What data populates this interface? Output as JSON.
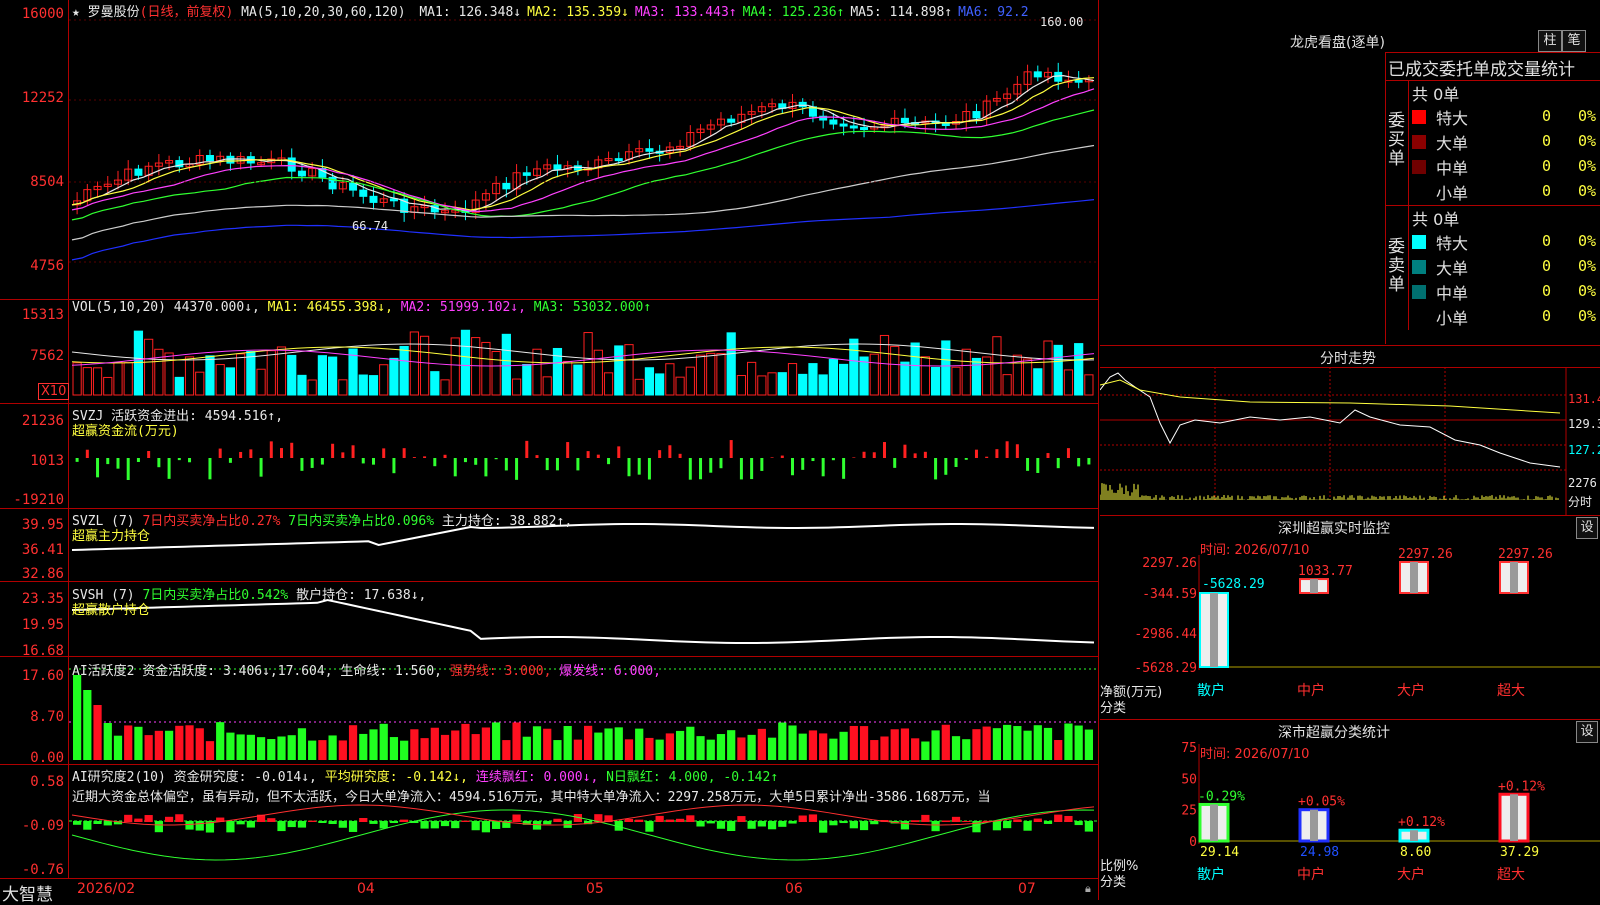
{
  "stock": {
    "name": "罗曼股份",
    "period": "(日线，前复权)",
    "ma_header": "MA(5,10,20,30,60,120)",
    "ma_values": [
      {
        "label": "MA1:",
        "value": "126.348",
        "arrow": "↓",
        "color": "#e8e8e8"
      },
      {
        "label": "MA2:",
        "value": "135.359",
        "arrow": "↓",
        "color": "#ffff40"
      },
      {
        "label": "MA3:",
        "value": "133.443",
        "arrow": "↑",
        "color": "#ff40ff"
      },
      {
        "label": "MA4:",
        "value": "125.236",
        "arrow": "↑",
        "color": "#30ff30"
      },
      {
        "label": "MA5:",
        "value": "114.898",
        "arrow": "↑",
        "color": "#e8e8e8"
      },
      {
        "label": "MA6:",
        "value": "92.2",
        "arrow": "",
        "color": "#4060ff"
      }
    ],
    "high_label": "160.00",
    "low_label": "66.74",
    "price_axis": [
      "16000",
      "12252",
      "8504",
      "4756"
    ]
  },
  "volume": {
    "header": "VOL(5,10,20)",
    "value": "44370.000↓,",
    "ma1": "MA1: 46455.398↓,",
    "ma2": "MA2: 51999.102↓,",
    "ma3": "MA3: 53032.000↑",
    "axis": [
      "15313",
      "7562"
    ],
    "unit": "X10"
  },
  "svzj": {
    "header": "SVZJ  活跃资金进出: 4594.516↑,",
    "sub": "超赢资金流(万元)",
    "axis": [
      "21236",
      "1013",
      "-19210"
    ]
  },
  "svzl": {
    "header_prefix": "SVZL (7)",
    "buy_ratio": "7日内买卖净占比0.27%",
    "net_ratio": "7日内买卖净占比0.096%",
    "main": "主力持仓: 38.882↑,",
    "sub": "超赢主力持仓",
    "axis": [
      "39.95",
      "36.41",
      "32.86"
    ]
  },
  "svsh": {
    "header_prefix": "SVSH (7)",
    "net_ratio": "7日内买卖净占比0.542%",
    "retail": "散户持仓: 17.638↓,",
    "sub": "超赢散户持仓",
    "axis": [
      "23.35",
      "19.95",
      "16.68"
    ]
  },
  "ai_active": {
    "header": "AI活跃度2 资金活跃度: 3.406↓,17.604,",
    "life": "生命线: 1.560,",
    "strong": "强势线: 3.000,",
    "burst": "爆发线: 6.000,",
    "axis": [
      "17.60",
      "8.70",
      "0.00"
    ]
  },
  "ai_research": {
    "header": "AI研究度2(10) 资金研究度: -0.014↓,",
    "avg": "平均研究度: -0.142↓,",
    "cont": "连续飘红: 0.000↓,",
    "nday": "N日飘红: 4.000, -0.142↑",
    "comment": "近期大资金总体偏空，虽有异动，但不太活跃，今日大单净流入：4594.516万元，其中特大单净流入：2297.258万元，大单5日累计净出-3586.168万元，当",
    "axis": [
      "0.58",
      "-0.09",
      "-0.76"
    ]
  },
  "date_axis": {
    "brand": "大智慧",
    "labels": [
      "2026/02",
      "04",
      "05",
      "06",
      "07"
    ]
  },
  "dragon": {
    "title": "龙虎看盘(逐单)",
    "btn1": "柱",
    "btn2": "笔",
    "subtitle": "已成交委托单成交量统计",
    "buy_side": "委买单",
    "sell_side": "委卖单",
    "buy_total": "共 0单",
    "sell_total": "共 0单",
    "buy_rows": [
      {
        "label": "特大",
        "count": "0",
        "pct": "0%",
        "color": "#ff0000"
      },
      {
        "label": "大单",
        "count": "0",
        "pct": "0%",
        "color": "#8b0000"
      },
      {
        "label": "中单",
        "count": "0",
        "pct": "0%",
        "color": "#700000"
      },
      {
        "label": "小单",
        "count": "0",
        "pct": "0%",
        "color": ""
      }
    ],
    "sell_rows": [
      {
        "label": "特大",
        "count": "0",
        "pct": "0%",
        "color": "#00ffff"
      },
      {
        "label": "大单",
        "count": "0",
        "pct": "0%",
        "color": "#008080"
      },
      {
        "label": "中单",
        "count": "0",
        "pct": "0%",
        "color": "#007070"
      },
      {
        "label": "小单",
        "count": "0",
        "pct": "0%",
        "color": ""
      }
    ]
  },
  "intraday": {
    "title": "分时走势",
    "price_axis": [
      "131.4",
      "129.3",
      "127.2"
    ],
    "vol_label": "2276",
    "vol_unit": "分时"
  },
  "monitor": {
    "title": "深圳超赢实时监控",
    "btn": "设",
    "time": "时间: 2026/07/10",
    "axis": [
      "2297.26",
      "-344.59",
      "-2986.44",
      "-5628.29"
    ],
    "net_label": "净额(万元)",
    "cat_label": "分类",
    "categories": [
      "散户",
      "中户",
      "大户",
      "超大"
    ],
    "values": [
      -5628.29,
      1033.77,
      2297.26,
      2297.26
    ],
    "value_labels": [
      "-5628.29",
      "1033.77",
      "2297.26",
      "2297.26"
    ]
  },
  "classify": {
    "title": "深市超赢分类统计",
    "btn": "设",
    "time": "时间: 2026/07/10",
    "axis": [
      "75",
      "50",
      "25",
      "0"
    ],
    "ratio_label": "比例%",
    "cat_label": "分类",
    "categories": [
      "散户",
      "中户",
      "大户",
      "超大"
    ],
    "values": [
      29.14,
      24.98,
      8.6,
      37.29
    ],
    "value_labels": [
      "29.14",
      "24.98",
      "8.60",
      "37.29"
    ],
    "changes": [
      "-0.29%",
      "+0.05%",
      "+0.12%",
      "+0.12%"
    ]
  }
}
